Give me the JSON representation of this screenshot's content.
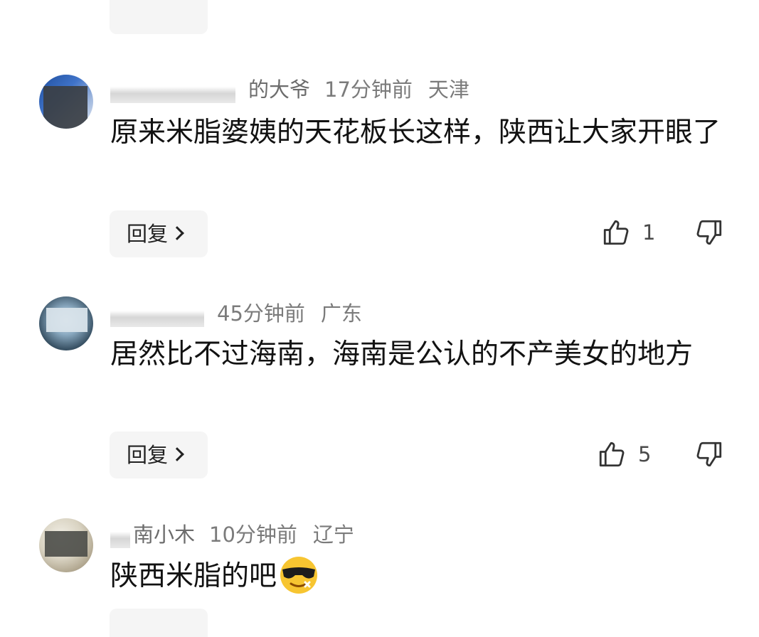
{
  "comments": [
    {
      "username_partial": "的大爷",
      "time": "17分钟前",
      "location": "天津",
      "text": "原来米脂婆姨的天花板长这样，陕西让大家开眼了",
      "reply_label": "回复",
      "likes": "1"
    },
    {
      "username_partial": "",
      "time": "45分钟前",
      "location": "广东",
      "text": "居然比不过海南，海南是公认的不产美女的地方",
      "reply_label": "回复",
      "likes": "5"
    },
    {
      "username_partial": "南小木",
      "time": "10分钟前",
      "location": "辽宁",
      "text": "陕西米脂的吧",
      "emoji": "sunglasses-emoji"
    }
  ],
  "colors": {
    "reply_bg": "#f5f5f5",
    "meta_text": "#7b7b7b",
    "body_text": "#121212"
  }
}
